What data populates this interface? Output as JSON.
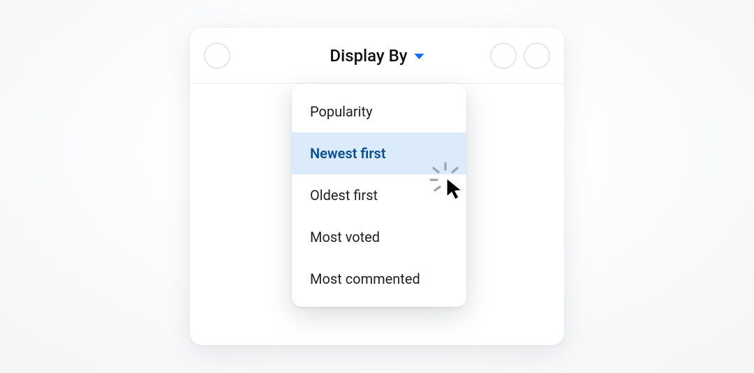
{
  "toolbar": {
    "display_by_label": "Display By"
  },
  "dropdown": {
    "selected_index": 1,
    "items": [
      {
        "label": "Popularity"
      },
      {
        "label": "Newest first"
      },
      {
        "label": "Oldest first"
      },
      {
        "label": "Most voted"
      },
      {
        "label": "Most commented"
      }
    ]
  }
}
